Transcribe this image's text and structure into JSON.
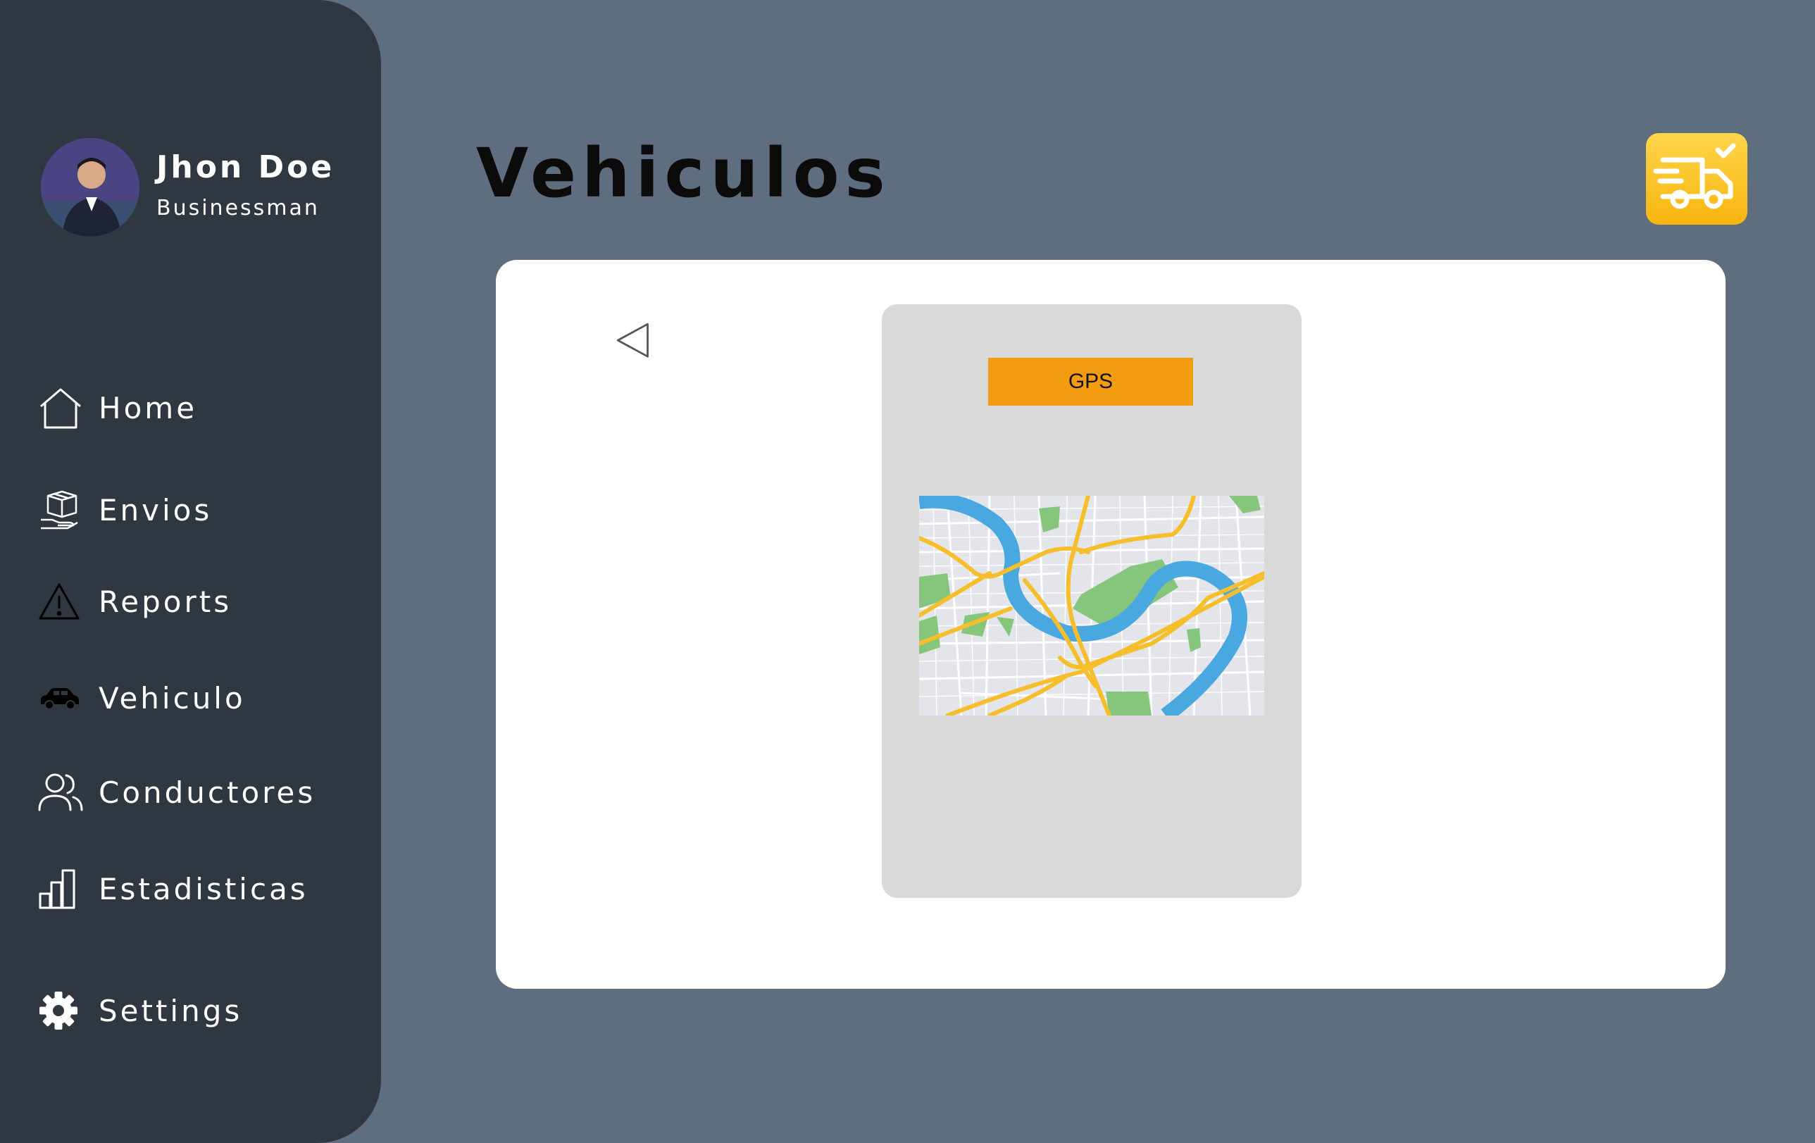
{
  "profile": {
    "name": "Jhon Doe",
    "role": "Businessman"
  },
  "nav": {
    "items": [
      {
        "label": "Home",
        "icon": "home-icon"
      },
      {
        "label": "Envios",
        "icon": "package-hand-icon"
      },
      {
        "label": "Reports",
        "icon": "warning-icon"
      },
      {
        "label": "Vehiculo",
        "icon": "car-icon"
      },
      {
        "label": "Conductores",
        "icon": "users-icon"
      },
      {
        "label": "Estadisticas",
        "icon": "bar-chart-icon"
      },
      {
        "label": "Settings",
        "icon": "gear-icon"
      }
    ]
  },
  "page": {
    "title": "Vehiculos"
  },
  "gps": {
    "button_label": "GPS"
  },
  "colors": {
    "background": "#5e6e7e",
    "sidebar": "#2f3741",
    "accent": "#f39c12",
    "panel": "#d9d9d9",
    "badge": "#f7b50f"
  }
}
